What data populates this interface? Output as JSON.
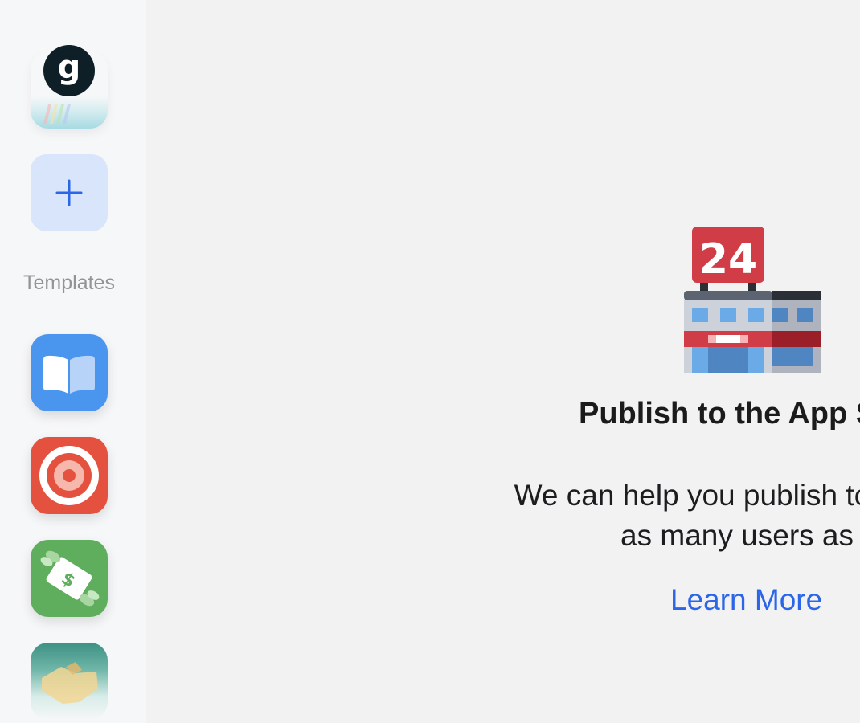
{
  "sidebar": {
    "logo_letter": "g",
    "templates_label": "Templates",
    "items": [
      {
        "name": "book-app-icon"
      },
      {
        "name": "target-app-icon"
      },
      {
        "name": "money-app-icon"
      },
      {
        "name": "handshake-app-icon"
      }
    ]
  },
  "main": {
    "badge_text": "24",
    "title": "Publish to the App S",
    "description_line1": "We can help you publish to the App St",
    "description_line2": "as many users as pos",
    "learn_more": "Learn More"
  },
  "colors": {
    "accent": "#2b66e8",
    "add_tile_bg": "#d9e5fb",
    "logo_bg": "#0f1f27"
  }
}
